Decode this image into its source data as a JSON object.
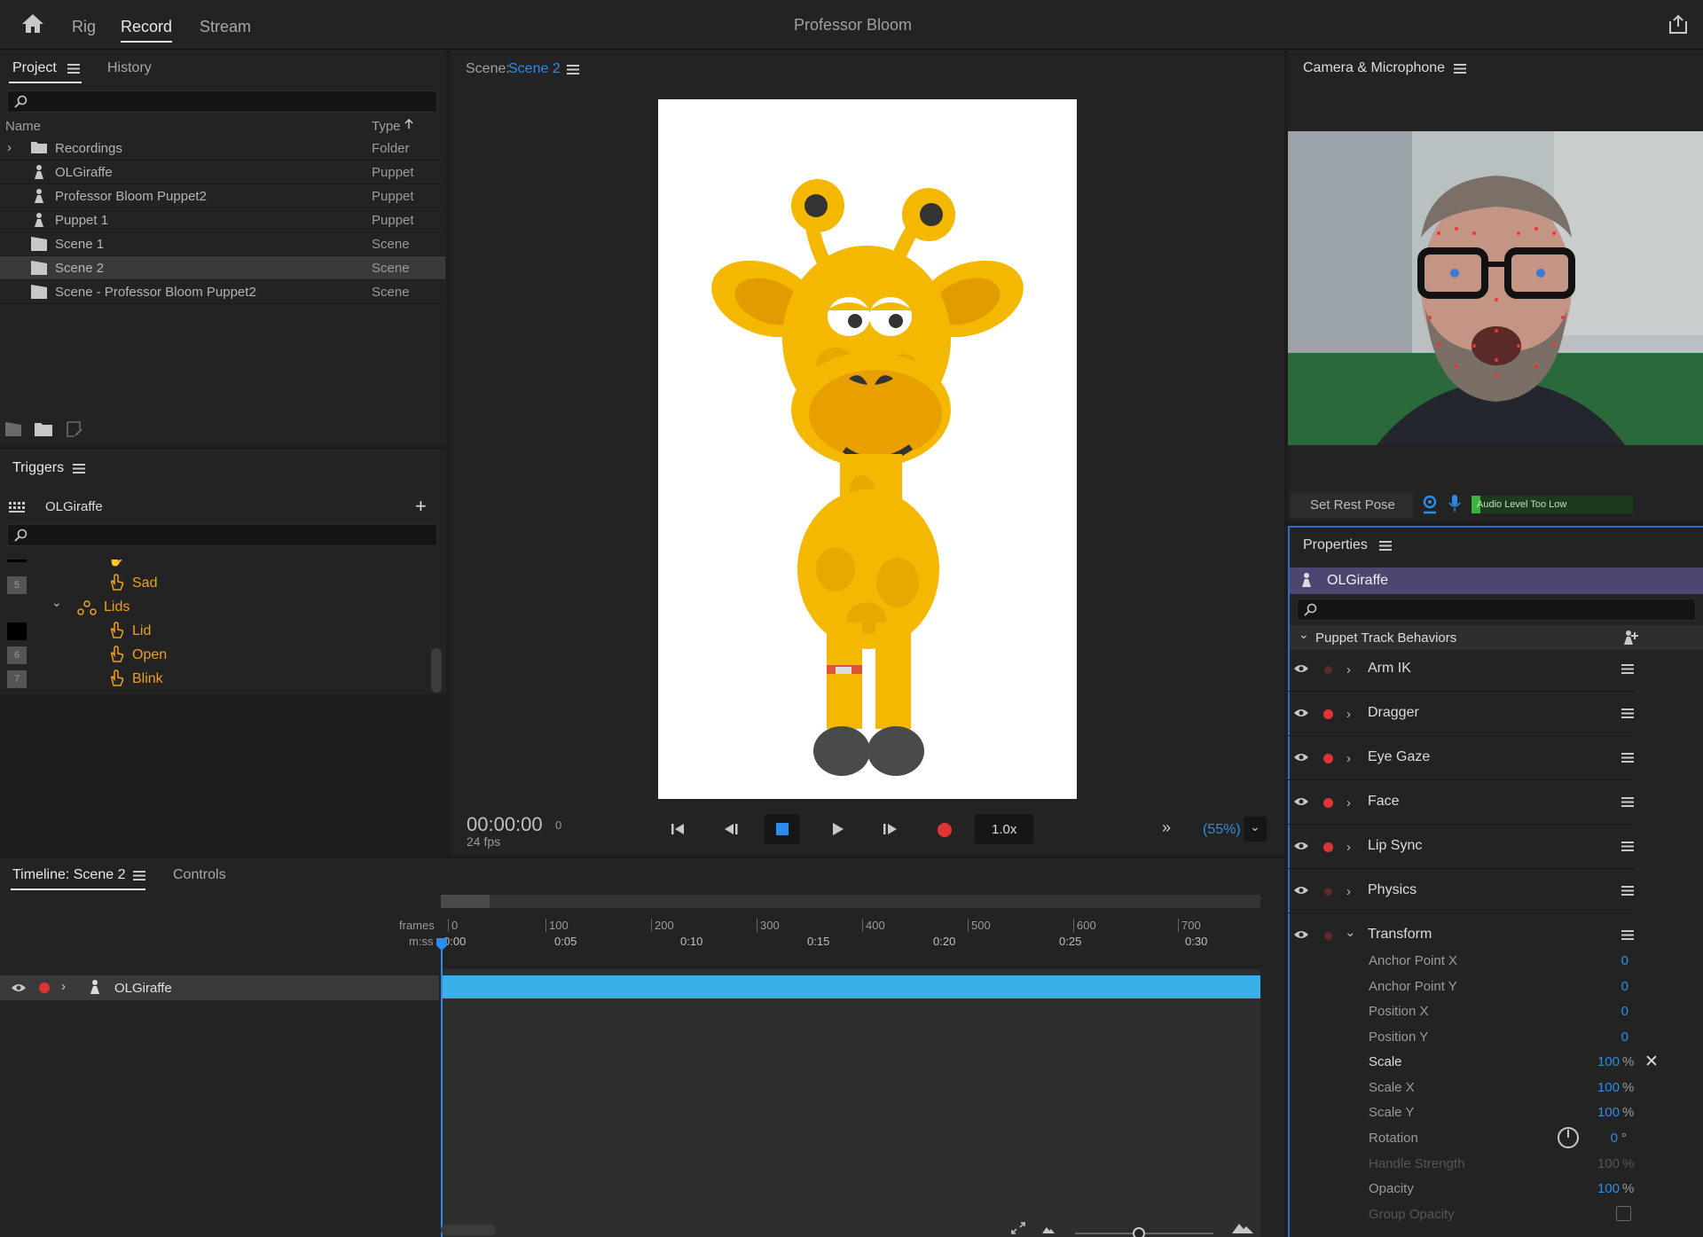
{
  "app": {
    "title": "Professor Bloom",
    "mode_tabs": [
      "Rig",
      "Record",
      "Stream"
    ],
    "active_mode": "Record"
  },
  "project": {
    "tabs": [
      "Project",
      "History"
    ],
    "columns": {
      "name": "Name",
      "type": "Type"
    },
    "items": [
      {
        "name": "Recordings",
        "type": "Folder",
        "icon": "folder-icon"
      },
      {
        "name": "OLGiraffe",
        "type": "Puppet",
        "icon": "puppet-icon"
      },
      {
        "name": "Professor Bloom Puppet2",
        "type": "Puppet",
        "icon": "puppet-icon"
      },
      {
        "name": "Puppet 1",
        "type": "Puppet",
        "icon": "puppet-icon"
      },
      {
        "name": "Scene 1",
        "type": "Scene",
        "icon": "scene-icon"
      },
      {
        "name": "Scene 2",
        "type": "Scene",
        "icon": "scene-icon",
        "selected": true
      },
      {
        "name": "Scene - Professor Bloom Puppet2",
        "type": "Scene",
        "icon": "scene-icon"
      }
    ]
  },
  "triggers": {
    "title": "Triggers",
    "puppet": "OLGiraffe",
    "items": [
      {
        "num": "5",
        "label": "Sad"
      },
      {
        "num": "",
        "label": "Lids",
        "group": true
      },
      {
        "num": "",
        "label": "Lid"
      },
      {
        "num": "6",
        "label": "Open"
      },
      {
        "num": "7",
        "label": "Blink"
      }
    ]
  },
  "scene": {
    "label": "Scene:",
    "name": "Scene 2",
    "timecode": "00:00:00",
    "frame": "0",
    "fps": "24 fps",
    "speed": "1.0x",
    "zoom": "(55%)"
  },
  "camera": {
    "title": "Camera & Microphone",
    "set_rest_pose": "Set Rest Pose",
    "audio_status": "Audio Level Too Low"
  },
  "properties": {
    "title": "Properties",
    "puppet": "OLGiraffe",
    "section": "Puppet Track Behaviors",
    "behaviors": [
      {
        "label": "Arm IK",
        "armed": false
      },
      {
        "label": "Dragger",
        "armed": true
      },
      {
        "label": "Eye Gaze",
        "armed": true
      },
      {
        "label": "Face",
        "armed": true
      },
      {
        "label": "Lip Sync",
        "armed": true
      },
      {
        "label": "Physics",
        "armed": false
      },
      {
        "label": "Transform",
        "armed": false,
        "expanded": true
      }
    ],
    "transform": [
      {
        "label": "Anchor Point X",
        "value": "0",
        "unit": ""
      },
      {
        "label": "Anchor Point Y",
        "value": "0",
        "unit": ""
      },
      {
        "label": "Position X",
        "value": "0",
        "unit": ""
      },
      {
        "label": "Position Y",
        "value": "0",
        "unit": ""
      },
      {
        "label": "Scale",
        "value": "100",
        "unit": "%"
      },
      {
        "label": "Scale X",
        "value": "100",
        "unit": "%"
      },
      {
        "label": "Scale Y",
        "value": "100",
        "unit": "%"
      },
      {
        "label": "Rotation",
        "value": "0",
        "unit": "°"
      },
      {
        "label": "Handle Strength",
        "value": "100",
        "unit": "%"
      },
      {
        "label": "Opacity",
        "value": "100",
        "unit": "%"
      },
      {
        "label": "Group Opacity",
        "value": "",
        "unit": ""
      }
    ]
  },
  "timeline": {
    "tabs": [
      "Timeline: Scene 2",
      "Controls"
    ],
    "frames_label": "frames",
    "mss_label": "m:ss",
    "frame_ticks": [
      "0",
      "100",
      "200",
      "300",
      "400",
      "500",
      "600",
      "700"
    ],
    "time_ticks": [
      "0:00",
      "0:05",
      "0:10",
      "0:15",
      "0:20",
      "0:25",
      "0:30"
    ],
    "track": "OLGiraffe"
  },
  "colors": {
    "accent": "#2d8ceb",
    "trigger": "#f0a020",
    "record": "#e03434",
    "track_bar": "#3ab0e8",
    "puppet_header": "#4e4670"
  }
}
